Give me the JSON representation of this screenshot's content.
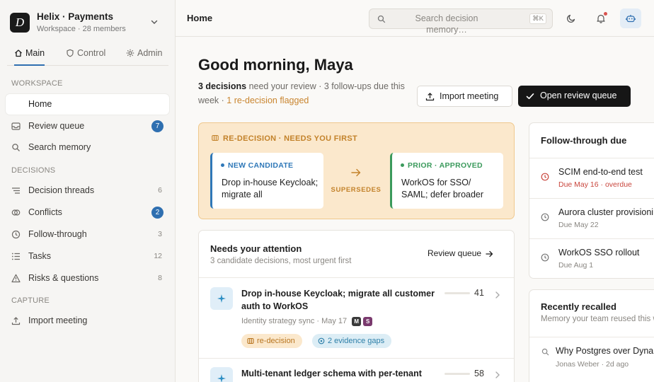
{
  "workspace": {
    "logo_letter": "D",
    "name": "Helix · Payments",
    "subtitle": "Workspace · 28 members"
  },
  "sidebar_tabs": [
    {
      "label": "Main",
      "icon": "home-icon",
      "active": true
    },
    {
      "label": "Control",
      "icon": "shield-icon",
      "active": false
    },
    {
      "label": "Admin",
      "icon": "gear-icon",
      "active": false
    }
  ],
  "sections": {
    "workspace": "WORKSPACE",
    "decisions": "DECISIONS",
    "capture": "CAPTURE"
  },
  "nav": {
    "home": {
      "label": "Home",
      "icon": "home-icon"
    },
    "review_queue": {
      "label": "Review queue",
      "badge": "7",
      "icon": "inbox-icon"
    },
    "search_memory": {
      "label": "Search memory",
      "icon": "search-icon"
    },
    "decision_threads": {
      "label": "Decision threads",
      "count": "6",
      "icon": "threads-icon"
    },
    "conflicts": {
      "label": "Conflicts",
      "badge": "2",
      "icon": "conflict-icon"
    },
    "follow_through": {
      "label": "Follow-through",
      "count": "3",
      "icon": "clock-icon"
    },
    "tasks": {
      "label": "Tasks",
      "count": "12",
      "icon": "list-icon"
    },
    "risks": {
      "label": "Risks & questions",
      "count": "8",
      "icon": "warning-icon"
    },
    "import_meeting": {
      "label": "Import meeting",
      "icon": "upload-icon"
    }
  },
  "header": {
    "title": "Home",
    "search_placeholder": "Search decision memory…",
    "search_shortcut": "⌘K"
  },
  "greeting": {
    "title": "Good morning, Maya",
    "count_bold": "3 decisions",
    "text": " need your review · 3 follow-ups due this week · ",
    "flag": "1 re-decision flagged"
  },
  "actions": {
    "import": "Import meeting",
    "open_queue": "Open review queue"
  },
  "redecision": {
    "header": "RE-DECISION · NEEDS YOU FIRST",
    "new": {
      "tag": "NEW CANDIDATE",
      "title": "Drop in-house Keycloak; migrate all"
    },
    "relation": "SUPERSEDES",
    "prior": {
      "tag": "PRIOR · APPROVED",
      "title": "WorkOS for SSO/ SAML; defer broader"
    },
    "colors": {
      "accent": "#c3822a",
      "background": "#fbe8cc",
      "new": "#2f78b8",
      "prior": "#3b9a5c"
    }
  },
  "attention": {
    "title": "Needs your attention",
    "subtitle": "3 candidate decisions, most urgent first",
    "link": "Review queue",
    "items": [
      {
        "title": "Drop in-house Keycloak; migrate all customer auth to WorkOS",
        "source": "Identity strategy sync · May 17",
        "avatars": [
          "M",
          "S"
        ],
        "score": "41",
        "tags": [
          {
            "label": "re-decision",
            "icon": "link-icon"
          },
          {
            "label": "2 evidence gaps",
            "icon": "target-icon"
          }
        ]
      },
      {
        "title": "Multi-tenant ledger schema with per-tenant",
        "score": "58"
      }
    ]
  },
  "follow_through": {
    "title": "Follow-through due",
    "items": [
      {
        "title": "SCIM end-to-end test",
        "due": "Due May 16 · overdue",
        "overdue": true
      },
      {
        "title": "Aurora cluster provisioning",
        "due": "Due May 22",
        "overdue": false
      },
      {
        "title": "WorkOS SSO rollout",
        "due": "Due Aug 1",
        "overdue": false
      }
    ]
  },
  "recalled": {
    "title": "Recently recalled",
    "subtitle": "Memory your team reused this week",
    "items": [
      {
        "query": "Why Postgres over DynamoDB",
        "by": "Jonas Weber · 2d ago"
      }
    ]
  }
}
